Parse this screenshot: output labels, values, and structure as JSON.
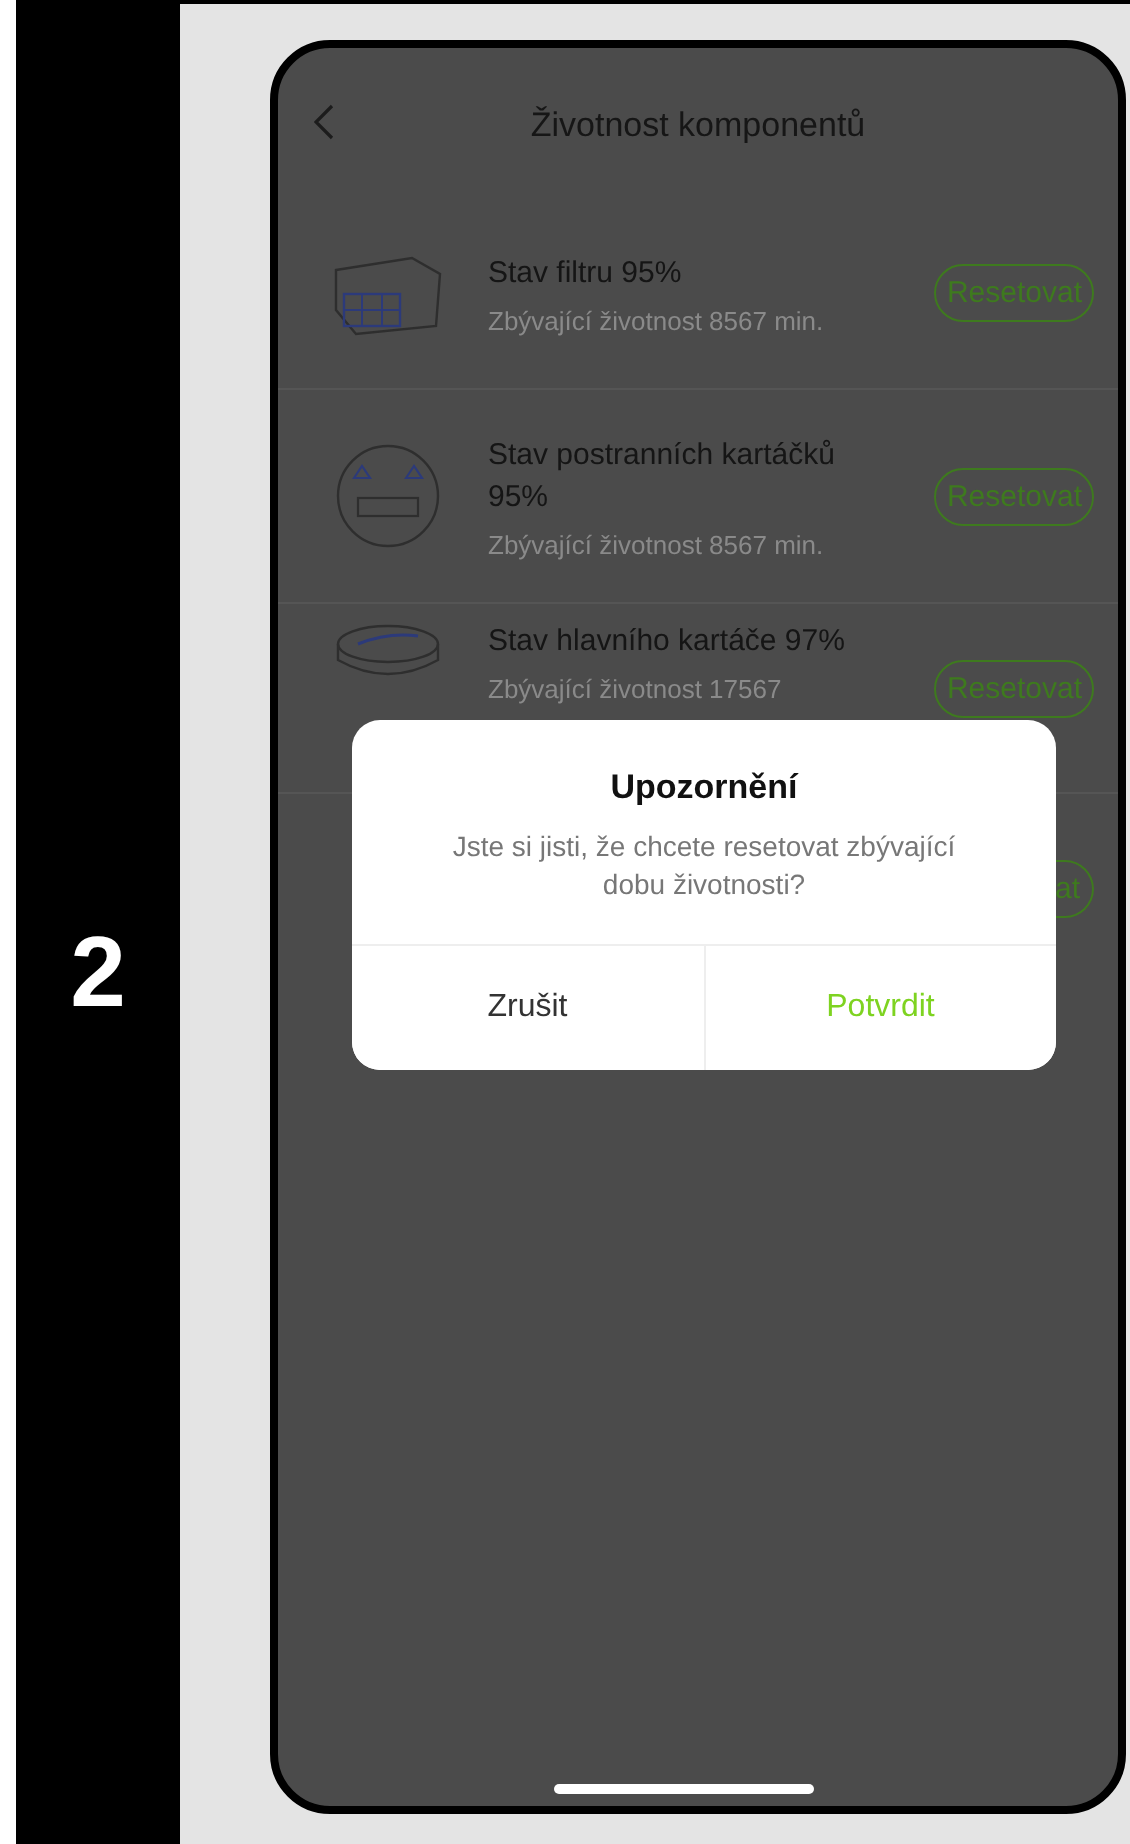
{
  "step": "2",
  "screen": {
    "title": "Životnost komponentů",
    "components": [
      {
        "kind": "filter",
        "title": "Stav filtru 95%",
        "remaining": "Zbývající životnost 8567 min.",
        "button": "Resetovat"
      },
      {
        "kind": "side-brush",
        "title": "Stav postranních kartáčků 95%",
        "remaining": "Zbývající životnost 8567 min.",
        "button": "Resetovat"
      },
      {
        "kind": "main-brush",
        "title": "Stav hlavního kartáče 97%",
        "remaining": "Zbývající životnost 17567",
        "button": "Resetovat"
      },
      {
        "kind": "partial",
        "button": "at"
      }
    ]
  },
  "dialog": {
    "title": "Upozornění",
    "message": "Jste si jisti, že chcete resetovat zbývající dobu životnosti?",
    "buttons": [
      {
        "kind": "cancel",
        "label": "Zrušit"
      },
      {
        "kind": "confirm",
        "label": "Potvrdit"
      }
    ]
  }
}
